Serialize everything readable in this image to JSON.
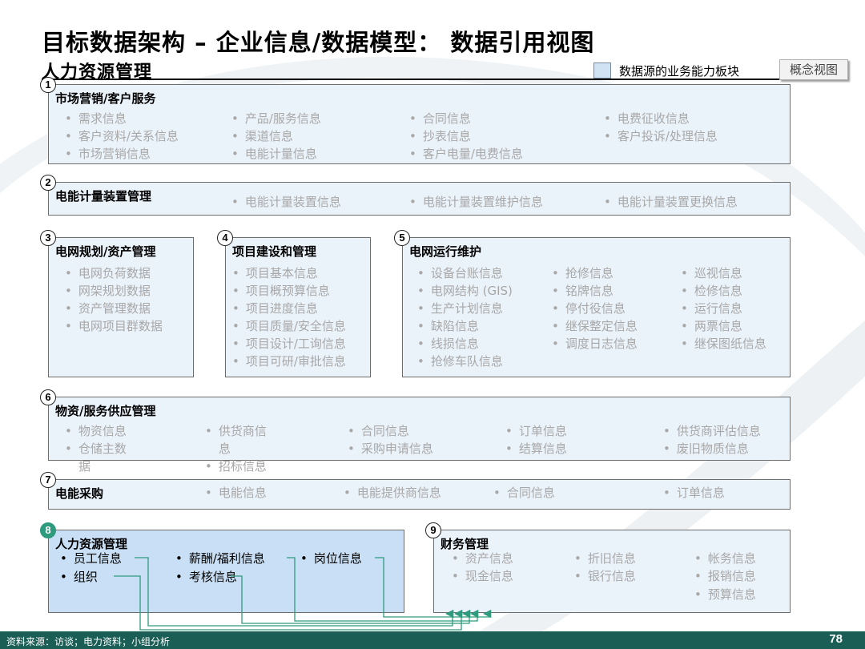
{
  "title": "目标数据架构 – 企业信息/数据模型： 数据引用视图",
  "subtitle": "人力资源管理",
  "legend_label": "数据源的业务能力板块",
  "view_tag": "概念视图",
  "colors": {
    "accent_green": "#2e9a7e",
    "box_fill": "#eaf2fa",
    "highlight_fill": "#c9dff5",
    "footer": "#1b5e56"
  },
  "boxes": {
    "b1": {
      "num": "1",
      "title": "市场营销/客户服务",
      "items": [
        "需求信息",
        "产品/服务信息",
        "合同信息",
        "电费征收信息",
        "客户资料/关系信息",
        "渠道信息",
        "抄表信息",
        "客户投诉/处理信息",
        "市场营销信息",
        "电能计量信息",
        "客户电量/电费信息"
      ]
    },
    "b2": {
      "num": "2",
      "title": "电能计量装置管理",
      "items": [
        "电能计量装置信息",
        "电能计量装置维护信息",
        "电能计量装置更换信息"
      ]
    },
    "b3": {
      "num": "3",
      "title": "电网规划/资产管理",
      "items": [
        "电网负荷数据",
        "网架规划数据",
        "资产管理数据",
        "电网项目群数据"
      ]
    },
    "b4": {
      "num": "4",
      "title": "项目建设和管理",
      "items": [
        "项目基本信息",
        "项目概预算信息",
        "项目进度信息",
        "项目质量/安全信息",
        "项目设计/工询信息",
        "项目可研/审批信息"
      ]
    },
    "b5": {
      "num": "5",
      "title": "电网运行维护",
      "items": [
        "设备台账信息",
        "抢修信息",
        "巡视信息",
        "电网结构 (GIS)",
        "铭牌信息",
        "检修信息",
        "生产计划信息",
        "停付役信息",
        "运行信息",
        "缺陷信息",
        "继保整定信息",
        "两票信息",
        "线损信息",
        "调度日志信息",
        "继保图纸信息",
        "抢修车队信息"
      ]
    },
    "b6": {
      "num": "6",
      "title": "物资/服务供应管理",
      "items": [
        "物资信息",
        "供货商信",
        "息",
        "合同信息",
        "订单信息",
        "供货商评估信息",
        "仓储主数",
        "据",
        "采购申请信息",
        "结算信息",
        "废旧物质信息",
        "招标信息"
      ]
    },
    "b7": {
      "num": "7",
      "title": "电能采购",
      "items": [
        "电能信息",
        "电能提供商信息",
        "合同信息",
        "订单信息"
      ]
    },
    "b8": {
      "num": "8",
      "title": "人力资源管理",
      "items": [
        "员工信息",
        "薪酬/福利信息",
        "岗位信息",
        "组织",
        "考核信息"
      ]
    },
    "b9": {
      "num": "9",
      "title": "财务管理",
      "items": [
        "资产信息",
        "折旧信息",
        "帐务信息",
        "现金信息",
        "银行信息",
        "报销信息",
        "预算信息"
      ]
    }
  },
  "footer": {
    "source": "资料来源：访谈；电力资料；小组分析",
    "page": "78"
  }
}
